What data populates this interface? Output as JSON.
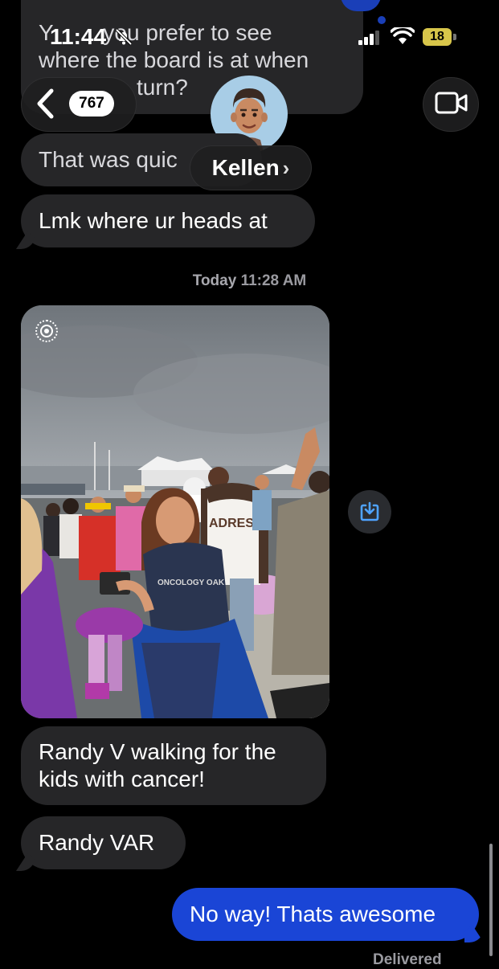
{
  "status_bar": {
    "time": "11:44",
    "battery": "18"
  },
  "header": {
    "back_count": "767",
    "contact_name": "Kellen",
    "chevron": "›"
  },
  "messages": {
    "partial_top": "Y… you prefer to see where the board is at when … turn?",
    "partial_line1": "Y",
    "partial_line1b": "you prefer to see",
    "partial_line2": "where the board is at when",
    "partial_line3": "turn?",
    "quick": "That was quic",
    "lmk": "Lmk where ur heads at",
    "timestamp_bold": "Today",
    "timestamp_time": "11:28 AM",
    "randy_v": "Randy V walking for the kids with cancer!",
    "randy_var": "Randy VAR",
    "outgoing": "No way! Thats awesome",
    "delivered": "Delivered"
  },
  "photo": {
    "jersey_text": "ADRES",
    "shirt_text": "ONCOLOGY OAK"
  },
  "colors": {
    "incoming_bubble": "#262628",
    "outgoing_bubble": "#1a45d6",
    "accent": "#2f8cff"
  }
}
